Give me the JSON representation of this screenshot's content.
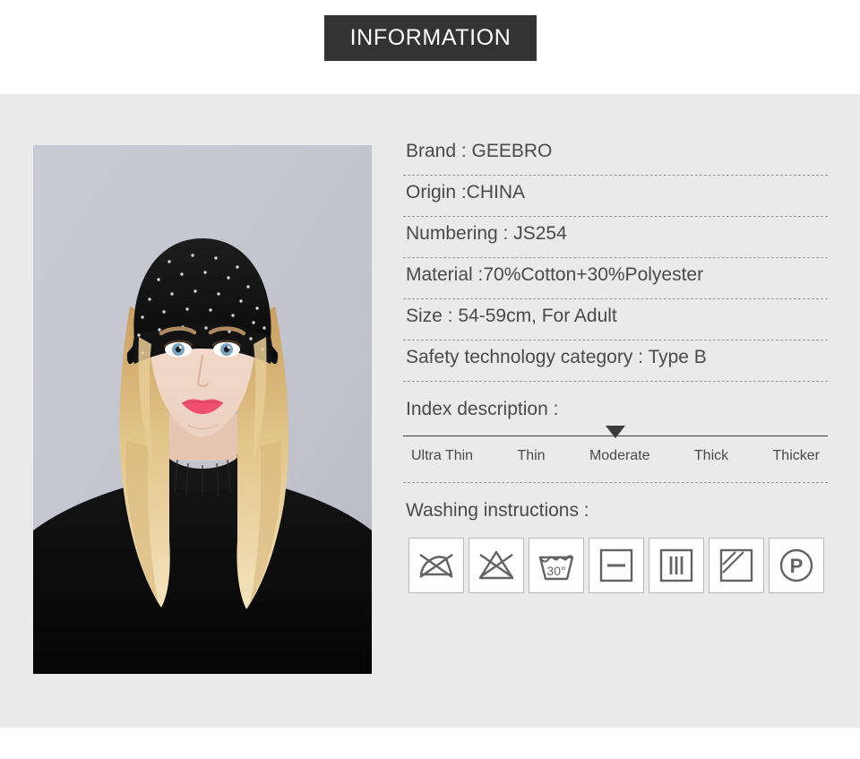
{
  "header": {
    "title": "INFORMATION",
    "banner_color": "#333333",
    "banner_text_color": "#ffffff"
  },
  "theme": {
    "page_background": "#ffffff",
    "panel_background": "#eaeaea",
    "text_color": "#4a4a4a",
    "divider_color": "#9b9b9b",
    "photo_backdrop": "#c3c4cd"
  },
  "product_photo": {
    "alt": "Female model wearing a black rhinestone-studded beanie hat with blonde hair and a black turtleneck sweater",
    "backdrop_color": "#c3c4cd",
    "hat_color": "#121212",
    "hair_color": "#e5c88c",
    "skin_color": "#f0d7c6",
    "lip_color": "#f0506e"
  },
  "specs": [
    {
      "name": "brand",
      "text": "Brand : GEEBRO"
    },
    {
      "name": "origin",
      "text": "Origin :CHINA"
    },
    {
      "name": "numbering",
      "text": "Numbering : JS254"
    },
    {
      "name": "material",
      "text": "Material :70%Cotton+30%Polyester"
    },
    {
      "name": "size",
      "text": "Size : 54-59cm, For Adult"
    },
    {
      "name": "safety",
      "text": "Safety technology category : Type B"
    }
  ],
  "index_description": {
    "label": "Index description :",
    "levels": [
      "Ultra Thin",
      "Thin",
      "Moderate",
      "Thick",
      "Thicker"
    ],
    "selected": "Moderate",
    "selected_index": 2,
    "marker_position_percent": 50
  },
  "washing": {
    "label": "Washing instructions :",
    "icons": [
      {
        "name": "do-not-iron-icon",
        "title": "Do not iron"
      },
      {
        "name": "do-not-bleach-icon",
        "title": "Do not bleach"
      },
      {
        "name": "wash-30-degrees-icon",
        "title": "Machine wash at 30°",
        "temperature": "30°"
      },
      {
        "name": "dry-flat-icon",
        "title": "Dry flat"
      },
      {
        "name": "drip-dry-icon",
        "title": "Drip dry"
      },
      {
        "name": "dry-in-shade-icon",
        "title": "Dry in shade"
      },
      {
        "name": "professional-dry-clean-icon",
        "title": "Professional dry clean",
        "letter": "P"
      }
    ]
  }
}
